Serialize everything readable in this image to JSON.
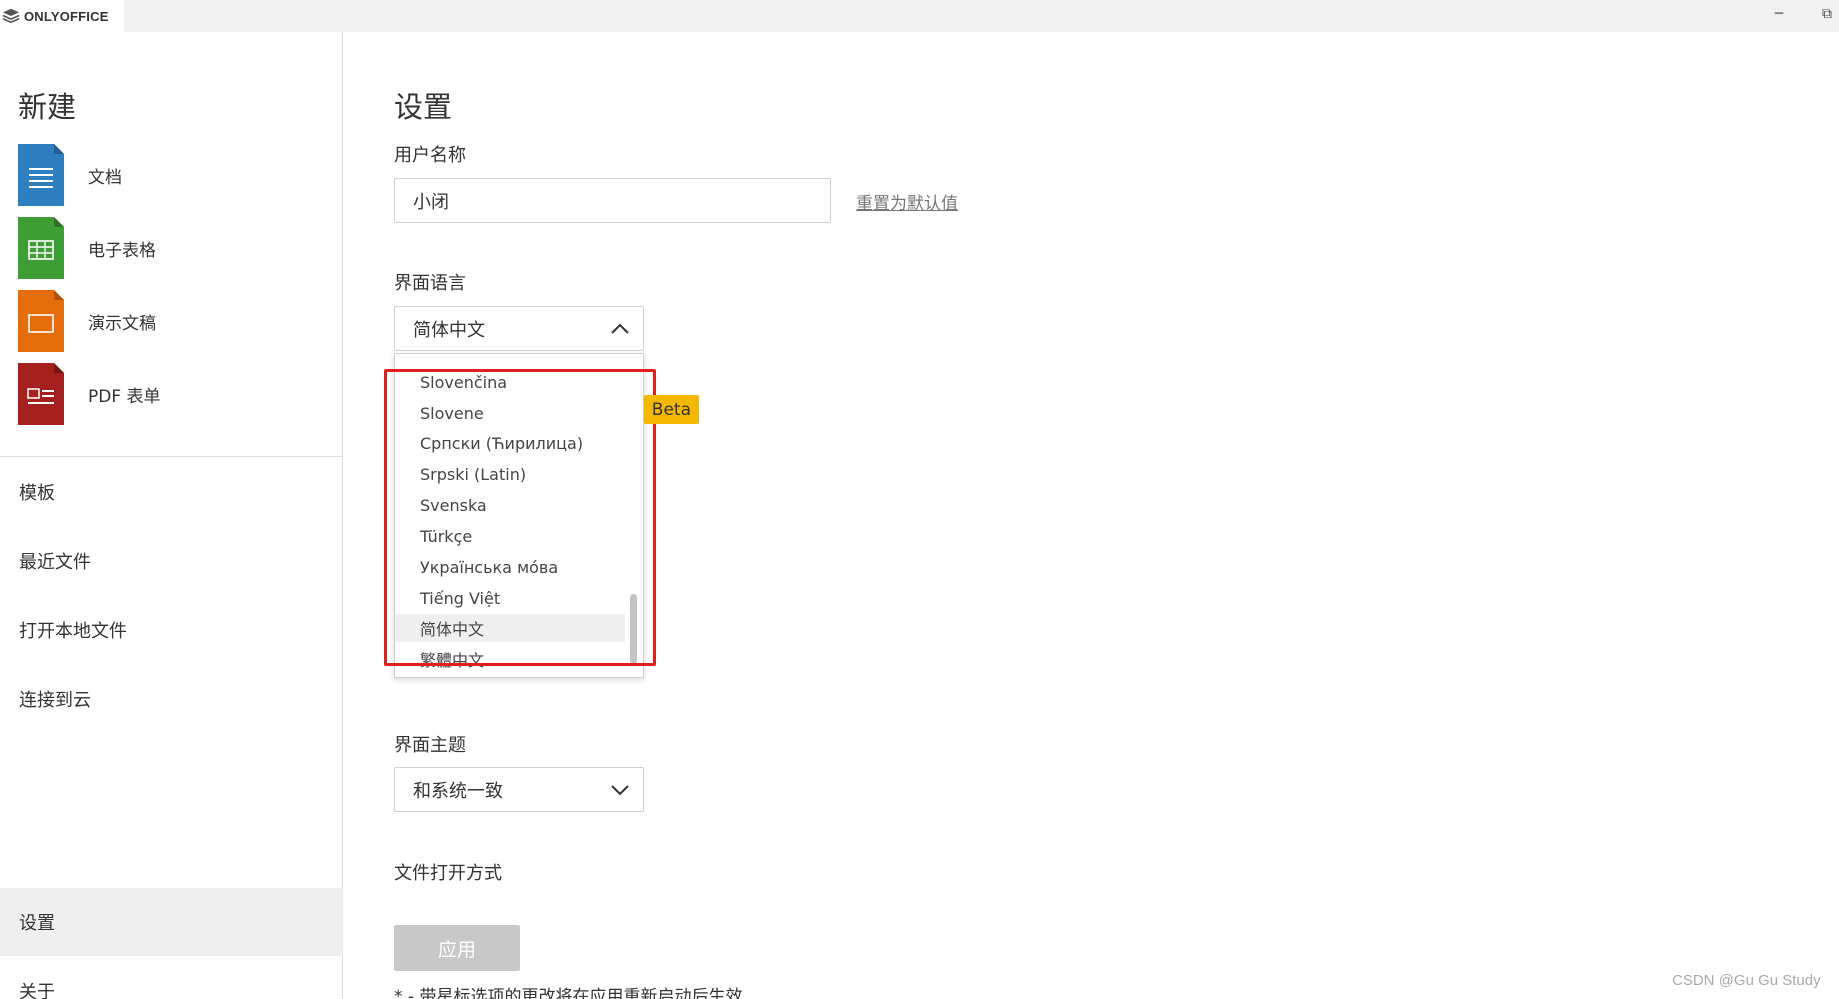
{
  "app": {
    "brand": "ONLYOFFICE"
  },
  "window_controls": {
    "minimize": "─",
    "maximize": "⧉"
  },
  "sidebar": {
    "new_title": "新建",
    "new_items": [
      {
        "label": "文档",
        "icon": "document-icon",
        "color": "#2e7fc0"
      },
      {
        "label": "电子表格",
        "icon": "spreadsheet-icon",
        "color": "#3f9d35"
      },
      {
        "label": "演示文稿",
        "icon": "presentation-icon",
        "color": "#e46c0a"
      },
      {
        "label": "PDF 表单",
        "icon": "pdf-form-icon",
        "color": "#a5201f"
      }
    ],
    "nav": [
      {
        "label": "模板"
      },
      {
        "label": "最近文件"
      },
      {
        "label": "打开本地文件"
      },
      {
        "label": "连接到云"
      },
      {
        "label": "设置",
        "active": true
      },
      {
        "label": "关于"
      }
    ]
  },
  "settings": {
    "title": "设置",
    "username_label": "用户名称",
    "username_value": "小闭",
    "reset_link": "重置为默认值",
    "language_label": "界面语言",
    "language_selected": "简体中文",
    "language_options": [
      "Slovenčina",
      "Slovene",
      "Српски (Ћирилица)",
      "Srpski (Latin)",
      "Svenska",
      "Türkçe",
      "Українська мо́ва",
      "Tiếng Việt",
      "简体中文",
      "繁體中文"
    ],
    "beta_badge": "Beta",
    "theme_label": "界面主题",
    "theme_selected": "和系统一致",
    "open_mode_label": "文件打开方式",
    "apply_button": "应用",
    "footnote": "* - 带星标选项的更改将在应用重新启动后生效"
  },
  "watermark": "CSDN @Gu Gu Study",
  "colors": {
    "accent_beta": "#f5b800",
    "highlight_box": "#e0201f",
    "apply_disabled": "#c8c8c8"
  }
}
